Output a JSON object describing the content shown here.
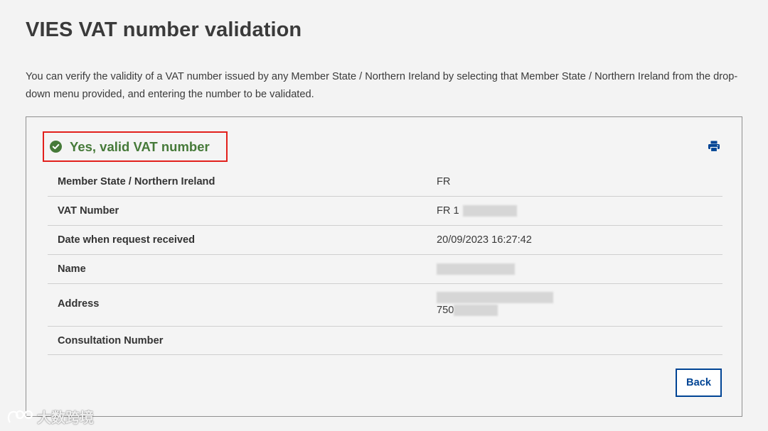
{
  "page": {
    "title": "VIES VAT number validation",
    "intro": "You can verify the validity of a VAT number issued by any Member State / Northern Ireland by selecting that Member State / Northern Ireland from the drop-down menu provided, and entering the number to be validated."
  },
  "result": {
    "status_text": "Yes, valid VAT number",
    "status_icon": "check-circle-icon",
    "status_color": "#467a39",
    "highlight_color": "#e2201c",
    "print_icon": "printer-icon"
  },
  "details": [
    {
      "label": "Member State / Northern Ireland",
      "value": "FR"
    },
    {
      "label": "VAT Number",
      "value": "FR 1"
    },
    {
      "label": "Date when request received",
      "value": "20/09/2023 16:27:42"
    },
    {
      "label": "Name",
      "value": ""
    },
    {
      "label": "Address",
      "value": "",
      "value_line2": "750"
    },
    {
      "label": "Consultation Number",
      "value": ""
    }
  ],
  "actions": {
    "back_label": "Back",
    "accent_color": "#004494"
  },
  "watermark": {
    "text": "大数跨境"
  }
}
